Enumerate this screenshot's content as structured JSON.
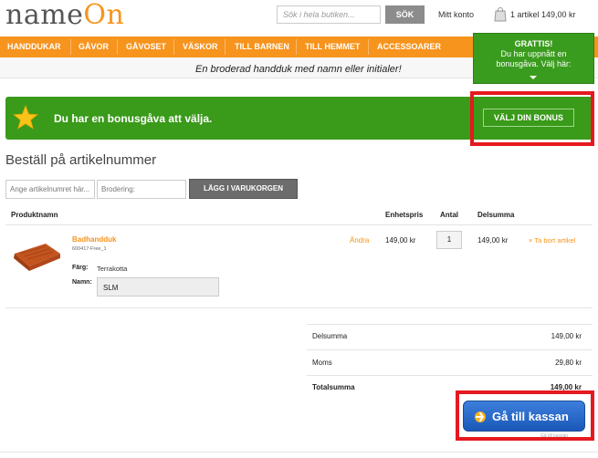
{
  "header": {
    "logo_part1": "name",
    "logo_part2": "On",
    "search_placeholder": "Sök i hela butiken...",
    "search_button": "SÖK",
    "account": "Mitt konto",
    "cart_summary": "1 artikel 149,00 kr"
  },
  "nav": {
    "items": [
      "HANDDUKAR",
      "GÅVOR",
      "GÅVOSET",
      "VÄSKOR",
      "TILL BARNEN",
      "TILL HEMMET",
      "ACCESSOARER"
    ]
  },
  "subnav_text": "En broderad handduk med namn eller initialer!",
  "grattis": {
    "title": "GRATTIS!",
    "line1": "Du har uppnått en",
    "line2": "bonusgåva. Välj här:"
  },
  "bonus": {
    "text": "Du har en bonusgåva att välja.",
    "button": "VÄLJ DIN BONUS"
  },
  "order_by_number": {
    "heading": "Beställ på artikelnummer",
    "article_placeholder": "Ange artikelnumret här...",
    "embroidery_placeholder": "Brodering:",
    "add_button": "LÄGG I VARUKORGEN"
  },
  "table": {
    "headers": {
      "product": "Produktnamn",
      "unit_price": "Enhetspris",
      "quantity": "Antal",
      "subtotal": "Delsumma"
    },
    "rows": [
      {
        "name": "Badhandduk",
        "code": "600417-Free_1",
        "color_label": "Färg:",
        "color_value": "Terrakotta",
        "name_label": "Namn:",
        "name_value": "SLM",
        "edit": "Ändra",
        "unit_price": "149,00 kr",
        "quantity": "1",
        "subtotal": "149,00 kr",
        "remove": "× Ta bort artikel"
      }
    ]
  },
  "totals": {
    "subtotal_label": "Delsumma",
    "subtotal_value": "149,00 kr",
    "tax_label": "Moms",
    "tax_value": "29,80 kr",
    "total_label": "Totalsumma",
    "total_value": "149,00 kr"
  },
  "checkout_button": "Gå till kassan",
  "footnote": "Gå till kassan",
  "colors": {
    "brand_orange": "#f7941d",
    "bonus_green": "#3a9a1a",
    "checkout_blue": "#1f63c4",
    "highlight_red": "#e5191f"
  }
}
